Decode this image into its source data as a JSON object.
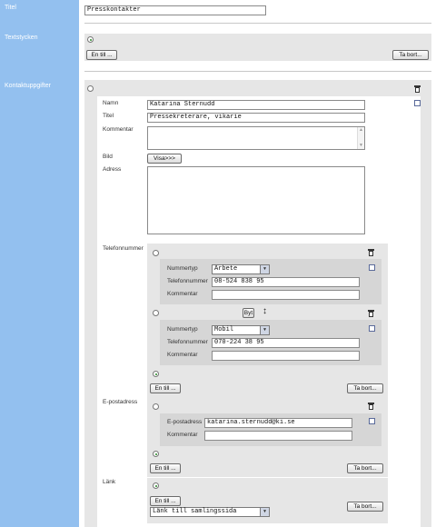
{
  "fields": {
    "titel": "Titel",
    "textstycken": "Textstycken",
    "kontaktuppgifter": "Kontaktuppgifter"
  },
  "titel_value": "Presskontakter",
  "buttons": {
    "en_till": "En till ...",
    "ta_bort": "Ta bort...",
    "visa": "Visa>>>",
    "byt": "Byt"
  },
  "contact": {
    "labels": {
      "namn": "Namn",
      "titel": "Titel",
      "kommentar": "Kommentar",
      "bild": "Bild",
      "adress": "Adress",
      "telefonnummer": "Telefonnummer",
      "epostadress": "E-postadress",
      "lank": "Länk"
    },
    "namn": "Katarina Sternudd",
    "titel": "Pressekreterare, vikarie"
  },
  "phones": {
    "labels": {
      "nummertyp": "Nummertyp",
      "telefonnummer": "Telefonnummer",
      "kommentar": "Kommentar"
    },
    "items": [
      {
        "nummertyp": "Arbete",
        "telefonnummer": "08-524 838 95"
      },
      {
        "nummertyp": "Mobil",
        "telefonnummer": "070-224 38 95"
      }
    ]
  },
  "email": {
    "labels": {
      "epostadress": "E-postadress",
      "kommentar": "Kommentar"
    },
    "value": "katarina.sternudd@ki.se"
  },
  "link": {
    "select": "Länk till samlingssida"
  },
  "icons": {
    "trash": "trash-icon",
    "updown": "up-down-arrow-icon",
    "dropdown": "chevron-down-icon"
  }
}
